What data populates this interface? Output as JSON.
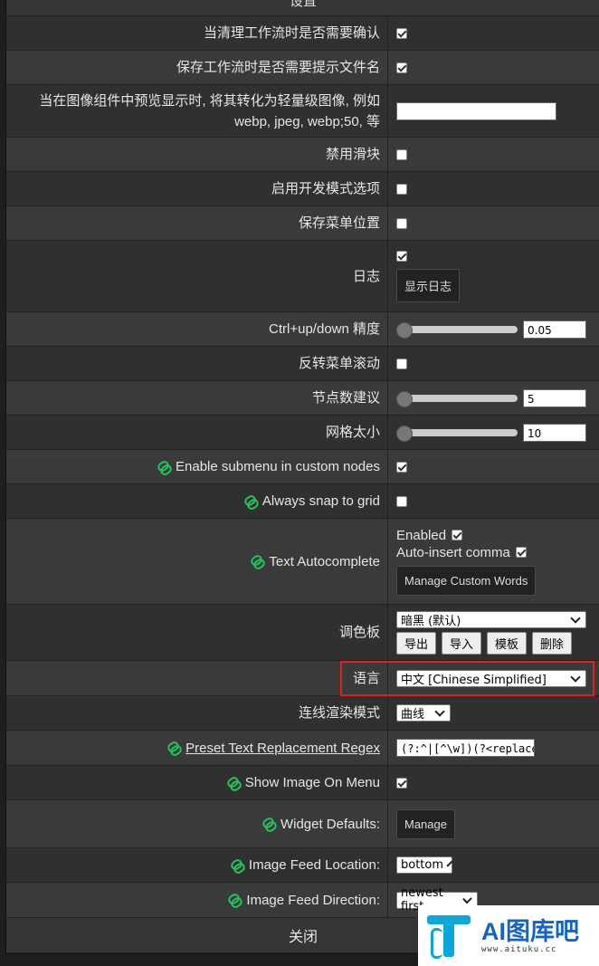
{
  "title": "设置",
  "rows": {
    "confirm_clear": {
      "label": "当清理工作流时是否需要确认",
      "checked": true
    },
    "prompt_filename": {
      "label": "保存工作流时是否需要提示文件名",
      "checked": true
    },
    "preview_format": {
      "label": "当在图像组件中预览显示时, 将其转化为轻量级图像, 例如 webp, jpeg, webp;50, 等",
      "value": ""
    },
    "disable_sliders": {
      "label": "禁用滑块",
      "checked": false
    },
    "dev_mode": {
      "label": "启用开发模式选项",
      "checked": false
    },
    "save_menu_pos": {
      "label": "保存菜单位置",
      "checked": false
    },
    "log": {
      "label": "日志",
      "checked": true,
      "button": "显示日志"
    },
    "ctrl_precision": {
      "label": "Ctrl+up/down 精度",
      "value": "0.05",
      "level": 0.05
    },
    "invert_menu_scroll": {
      "label": "反转菜单滚动",
      "checked": false
    },
    "node_suggestions": {
      "label": "节点数建议",
      "value": "5",
      "level": 0.05
    },
    "grid_size": {
      "label": "网格太小",
      "value": "10",
      "level": 0.05
    },
    "submenu_custom": {
      "label": "Enable submenu in custom nodes",
      "checked": true,
      "icon": "link-icon"
    },
    "snap_grid": {
      "label": "Always snap to grid",
      "checked": false,
      "icon": "link-icon"
    },
    "autocomplete": {
      "label": "Text Autocomplete",
      "icon": "link-icon",
      "enabled_label": "Enabled",
      "enabled": true,
      "comma_label": "Auto-insert comma",
      "comma": true,
      "button": "Manage Custom Words"
    },
    "palette": {
      "label": "调色板",
      "selected": "暗黑 (默认)",
      "buttons": [
        "导出",
        "导入",
        "模板",
        "删除"
      ]
    },
    "language": {
      "label": "语言",
      "selected": "中文 [Chinese Simplified]"
    },
    "link_render": {
      "label": "连线渲染模式",
      "selected": "曲线"
    },
    "preset_regex": {
      "label": "Preset Text Replacement Regex",
      "value": "(?:^|[^\\w])(?<replace",
      "icon": "link-icon"
    },
    "show_image_menu": {
      "label": "Show Image On Menu",
      "checked": true,
      "icon": "link-icon"
    },
    "widget_defaults": {
      "label": "Widget Defaults:",
      "button": "Manage",
      "icon": "link-icon"
    },
    "feed_location": {
      "label": "Image Feed Location:",
      "selected": "bottom",
      "icon": "link-icon"
    },
    "feed_direction": {
      "label": "Image Feed Direction:",
      "selected": "newest first",
      "icon": "link-icon"
    }
  },
  "close": "关闭",
  "watermark": {
    "brand": "AI图库吧",
    "url": "www.aituku.cc"
  },
  "colors": {
    "accent_icon": "#22c55e",
    "highlight": "#e02020"
  }
}
